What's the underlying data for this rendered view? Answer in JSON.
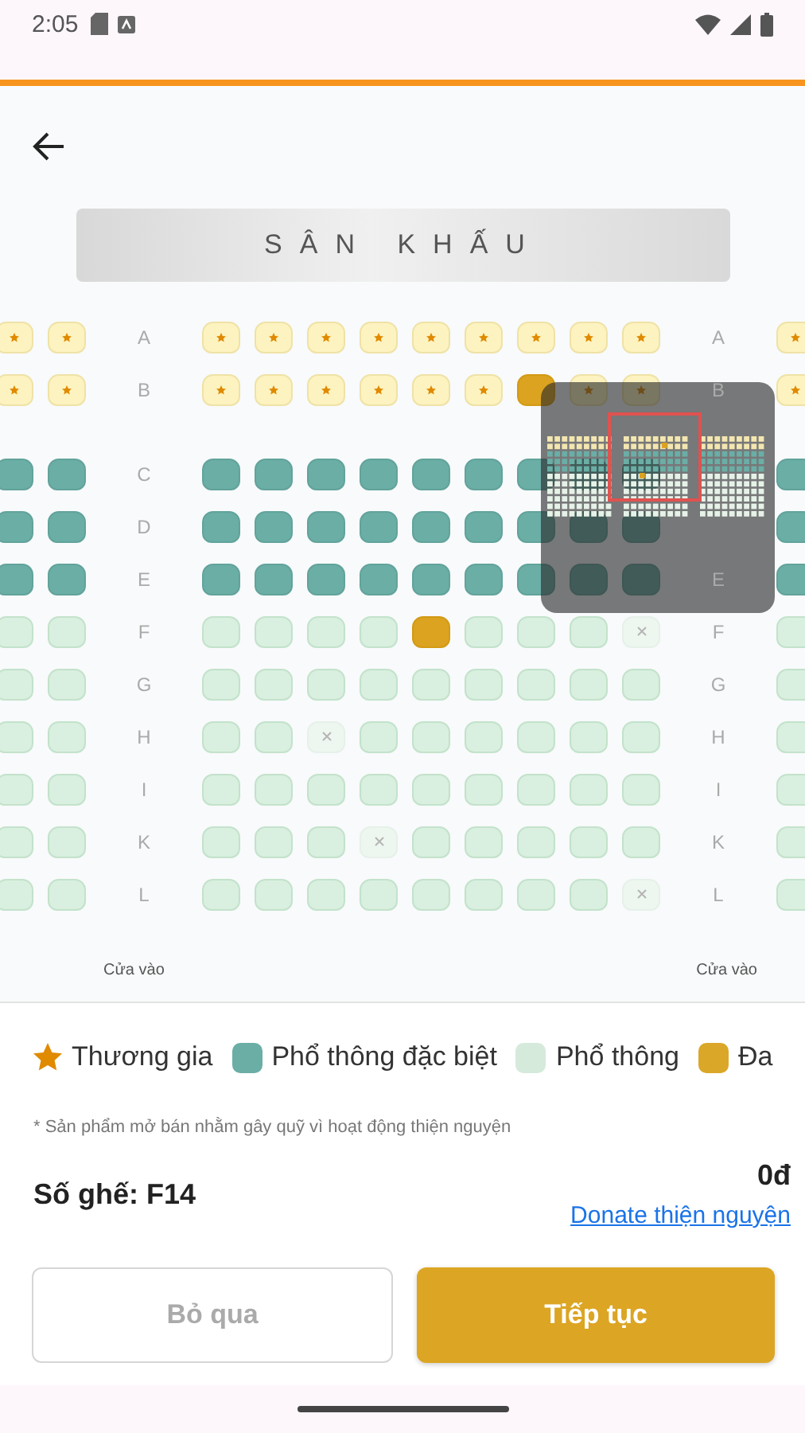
{
  "status_bar": {
    "time": "2:05"
  },
  "stage": {
    "label": "SÂN KHẤU"
  },
  "rows": [
    {
      "left_label": "A",
      "right_label": "A",
      "kind": "business",
      "left_seats": [
        {
          "selected": false,
          "sold": false
        },
        {
          "selected": false,
          "sold": false
        }
      ],
      "center_seats": [
        {
          "selected": false,
          "sold": false
        },
        {
          "selected": false,
          "sold": false
        },
        {
          "selected": false,
          "sold": false
        },
        {
          "selected": false,
          "sold": false
        },
        {
          "selected": false,
          "sold": false
        },
        {
          "selected": false,
          "sold": false
        },
        {
          "selected": false,
          "sold": false
        },
        {
          "selected": false,
          "sold": false
        },
        {
          "selected": false,
          "sold": false
        }
      ],
      "right_seats": [
        {
          "selected": false,
          "sold": false
        }
      ]
    },
    {
      "left_label": "B",
      "right_label": "B",
      "kind": "business",
      "left_seats": [
        {
          "selected": false,
          "sold": false
        },
        {
          "selected": false,
          "sold": false
        }
      ],
      "center_seats": [
        {
          "selected": false,
          "sold": false
        },
        {
          "selected": false,
          "sold": false
        },
        {
          "selected": false,
          "sold": false
        },
        {
          "selected": false,
          "sold": false
        },
        {
          "selected": false,
          "sold": false
        },
        {
          "selected": false,
          "sold": false
        },
        {
          "selected": true,
          "sold": false
        },
        {
          "selected": false,
          "sold": false
        },
        {
          "selected": false,
          "sold": false
        }
      ],
      "right_seats": [
        {
          "selected": false,
          "sold": false
        }
      ]
    },
    {
      "left_label": "C",
      "kind": "premium",
      "left_seats": [
        {
          "selected": false,
          "sold": false
        },
        {
          "selected": false,
          "sold": false
        }
      ],
      "center_seats": [
        {
          "selected": false,
          "sold": false
        },
        {
          "selected": false,
          "sold": false
        },
        {
          "selected": false,
          "sold": false
        },
        {
          "selected": false,
          "sold": false
        },
        {
          "selected": false,
          "sold": false
        },
        {
          "selected": false,
          "sold": false
        },
        {
          "selected": false,
          "sold": false
        },
        {
          "selected": false,
          "sold": false
        },
        {
          "selected": false,
          "sold": false
        }
      ],
      "right_seats": [
        {
          "selected": false,
          "sold": false
        }
      ]
    },
    {
      "left_label": "D",
      "kind": "premium",
      "left_seats": [
        {
          "selected": false,
          "sold": false
        },
        {
          "selected": false,
          "sold": false
        }
      ],
      "center_seats": [
        {
          "selected": false,
          "sold": false
        },
        {
          "selected": false,
          "sold": false
        },
        {
          "selected": false,
          "sold": false
        },
        {
          "selected": false,
          "sold": false
        },
        {
          "selected": false,
          "sold": false
        },
        {
          "selected": false,
          "sold": false
        },
        {
          "selected": false,
          "sold": false
        },
        {
          "selected": false,
          "sold": false
        },
        {
          "selected": false,
          "sold": false
        }
      ],
      "right_seats": [
        {
          "selected": false,
          "sold": false
        }
      ]
    },
    {
      "left_label": "E",
      "right_label": "E",
      "kind": "premium",
      "left_seats": [
        {
          "selected": false,
          "sold": false
        },
        {
          "selected": false,
          "sold": false
        }
      ],
      "center_seats": [
        {
          "selected": false,
          "sold": false
        },
        {
          "selected": false,
          "sold": false
        },
        {
          "selected": false,
          "sold": false
        },
        {
          "selected": false,
          "sold": false
        },
        {
          "selected": false,
          "sold": false
        },
        {
          "selected": false,
          "sold": false
        },
        {
          "selected": false,
          "sold": false
        },
        {
          "selected": false,
          "sold": false
        },
        {
          "selected": false,
          "sold": false
        }
      ],
      "right_seats": [
        {
          "selected": false,
          "sold": false
        }
      ]
    },
    {
      "left_label": "F",
      "right_label": "F",
      "kind": "economy",
      "left_seats": [
        {
          "selected": false,
          "sold": false
        },
        {
          "selected": false,
          "sold": false
        }
      ],
      "center_seats": [
        {
          "selected": false,
          "sold": false
        },
        {
          "selected": false,
          "sold": false
        },
        {
          "selected": false,
          "sold": false
        },
        {
          "selected": false,
          "sold": false
        },
        {
          "selected": true,
          "sold": false
        },
        {
          "selected": false,
          "sold": false
        },
        {
          "selected": false,
          "sold": false
        },
        {
          "selected": false,
          "sold": false
        },
        {
          "selected": false,
          "sold": true
        }
      ],
      "right_seats": [
        {
          "selected": false,
          "sold": false
        }
      ]
    },
    {
      "left_label": "G",
      "right_label": "G",
      "kind": "economy",
      "left_seats": [
        {
          "selected": false,
          "sold": false
        },
        {
          "selected": false,
          "sold": false
        }
      ],
      "center_seats": [
        {
          "selected": false,
          "sold": false
        },
        {
          "selected": false,
          "sold": false
        },
        {
          "selected": false,
          "sold": false
        },
        {
          "selected": false,
          "sold": false
        },
        {
          "selected": false,
          "sold": false
        },
        {
          "selected": false,
          "sold": false
        },
        {
          "selected": false,
          "sold": false
        },
        {
          "selected": false,
          "sold": false
        },
        {
          "selected": false,
          "sold": false
        }
      ],
      "right_seats": [
        {
          "selected": false,
          "sold": false
        }
      ]
    },
    {
      "left_label": "H",
      "right_label": "H",
      "kind": "economy",
      "left_seats": [
        {
          "selected": false,
          "sold": false
        },
        {
          "selected": false,
          "sold": false
        }
      ],
      "center_seats": [
        {
          "selected": false,
          "sold": false
        },
        {
          "selected": false,
          "sold": false
        },
        {
          "selected": false,
          "sold": true
        },
        {
          "selected": false,
          "sold": false
        },
        {
          "selected": false,
          "sold": false
        },
        {
          "selected": false,
          "sold": false
        },
        {
          "selected": false,
          "sold": false
        },
        {
          "selected": false,
          "sold": false
        },
        {
          "selected": false,
          "sold": false
        }
      ],
      "right_seats": [
        {
          "selected": false,
          "sold": false
        }
      ]
    },
    {
      "left_label": "I",
      "right_label": "I",
      "kind": "economy",
      "left_seats": [
        {
          "selected": false,
          "sold": false
        },
        {
          "selected": false,
          "sold": false
        }
      ],
      "center_seats": [
        {
          "selected": false,
          "sold": false
        },
        {
          "selected": false,
          "sold": false
        },
        {
          "selected": false,
          "sold": false
        },
        {
          "selected": false,
          "sold": false
        },
        {
          "selected": false,
          "sold": false
        },
        {
          "selected": false,
          "sold": false
        },
        {
          "selected": false,
          "sold": false
        },
        {
          "selected": false,
          "sold": false
        },
        {
          "selected": false,
          "sold": false
        }
      ],
      "right_seats": [
        {
          "selected": false,
          "sold": false
        }
      ]
    },
    {
      "left_label": "K",
      "right_label": "K",
      "kind": "economy",
      "left_seats": [
        {
          "selected": false,
          "sold": false
        },
        {
          "selected": false,
          "sold": false
        }
      ],
      "center_seats": [
        {
          "selected": false,
          "sold": false
        },
        {
          "selected": false,
          "sold": false
        },
        {
          "selected": false,
          "sold": false
        },
        {
          "selected": false,
          "sold": true
        },
        {
          "selected": false,
          "sold": false
        },
        {
          "selected": false,
          "sold": false
        },
        {
          "selected": false,
          "sold": false
        },
        {
          "selected": false,
          "sold": false
        },
        {
          "selected": false,
          "sold": false
        }
      ],
      "right_seats": [
        {
          "selected": false,
          "sold": false
        }
      ]
    },
    {
      "left_label": "L",
      "right_label": "L",
      "kind": "economy",
      "left_seats": [
        {
          "selected": false,
          "sold": false
        },
        {
          "selected": false,
          "sold": false
        }
      ],
      "center_seats": [
        {
          "selected": false,
          "sold": false
        },
        {
          "selected": false,
          "sold": false
        },
        {
          "selected": false,
          "sold": false
        },
        {
          "selected": false,
          "sold": false
        },
        {
          "selected": false,
          "sold": false
        },
        {
          "selected": false,
          "sold": false
        },
        {
          "selected": false,
          "sold": false
        },
        {
          "selected": false,
          "sold": false
        },
        {
          "selected": false,
          "sold": true
        }
      ],
      "right_seats": [
        {
          "selected": false,
          "sold": false
        }
      ]
    }
  ],
  "entrances": [
    "Cửa vào",
    "Cửa vào"
  ],
  "legend": [
    {
      "kind": "star",
      "label": "Thương gia",
      "color": "#e08a00"
    },
    {
      "kind": "swatch",
      "label": "Phổ thông đặc biệt",
      "color": "#6aaea6"
    },
    {
      "kind": "swatch",
      "label": "Phổ thông",
      "color": "#d6eadb"
    },
    {
      "kind": "swatch",
      "label": "Đa",
      "color": "#dba728"
    }
  ],
  "note": "* Sản phẩm mở bán nhằm gây quỹ vì hoạt động thiện nguyện",
  "summary": {
    "seats": "Số ghế: F14",
    "price": "0đ",
    "donate_link": "Donate thiện nguyện"
  },
  "buttons": {
    "skip": "Bỏ qua",
    "continue": "Tiếp tục"
  }
}
